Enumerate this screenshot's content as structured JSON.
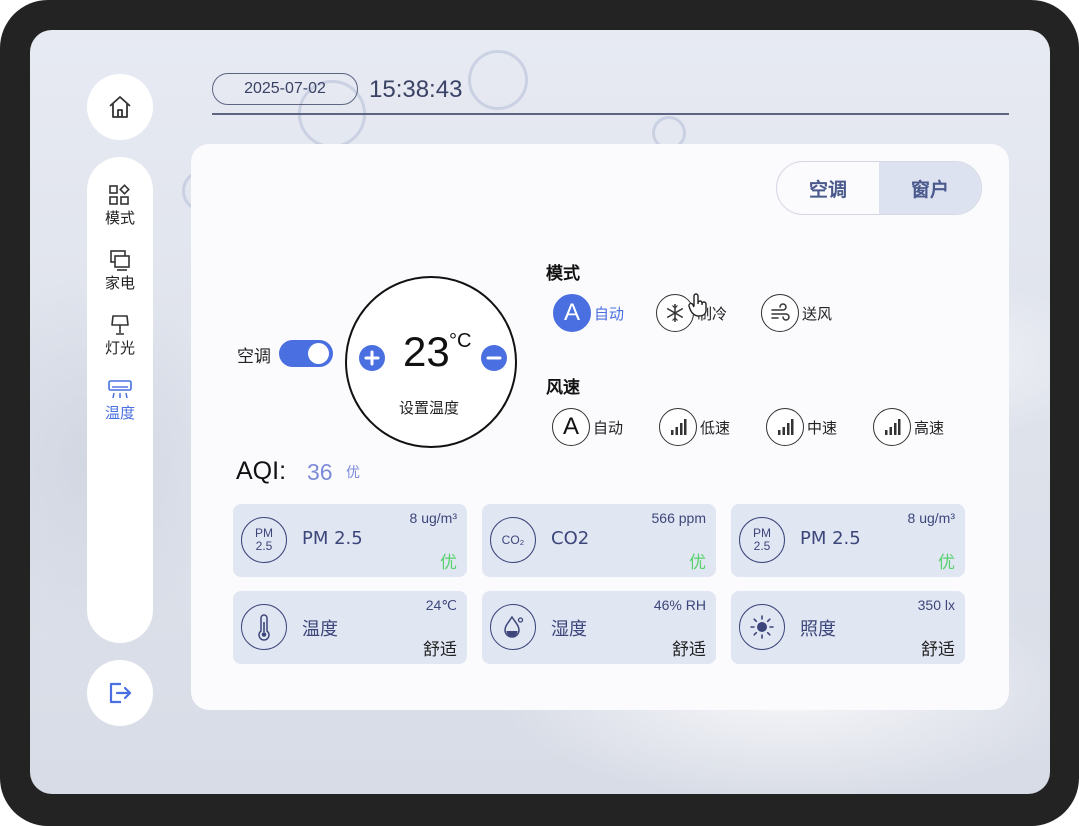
{
  "header": {
    "date": "2025-07-02",
    "time": "15:38:43"
  },
  "sidebar": {
    "items": [
      {
        "label": "模式",
        "icon": "grid-icon"
      },
      {
        "label": "家电",
        "icon": "appliance-icon"
      },
      {
        "label": "灯光",
        "icon": "lamp-icon"
      },
      {
        "label": "温度",
        "icon": "air-conditioner-icon"
      }
    ],
    "active": "温度"
  },
  "tabs": {
    "ac": "空调",
    "window": "窗户",
    "selected": "窗户"
  },
  "ac": {
    "label": "空调",
    "power": true,
    "temp": "23",
    "unit": "°C",
    "set_label": "设置温度"
  },
  "mode": {
    "title": "模式",
    "options": [
      {
        "label": "自动",
        "icon": "auto-icon",
        "selected": true
      },
      {
        "label": "制冷",
        "icon": "snowflake-icon",
        "selected": false
      },
      {
        "label": "送风",
        "icon": "wind-icon",
        "selected": false
      }
    ]
  },
  "fan": {
    "title": "风速",
    "options": [
      {
        "label": "自动",
        "icon": "auto-icon"
      },
      {
        "label": "低速",
        "icon": "signal-icon"
      },
      {
        "label": "中速",
        "icon": "signal-icon"
      },
      {
        "label": "高速",
        "icon": "signal-icon"
      }
    ]
  },
  "aqi": {
    "label": "AQI:",
    "value": "36",
    "level": "优"
  },
  "sensors": [
    {
      "name": "PM 2.5",
      "icon_text": "PM",
      "icon_sub": "2.5",
      "value": "8 ug/m³",
      "status": "优"
    },
    {
      "name": "CO2",
      "icon_text": "CO₂",
      "value": "566 ppm",
      "status": "优"
    },
    {
      "name": "PM 2.5",
      "icon_text": "PM",
      "icon_sub": "2.5",
      "value": "8 ug/m³",
      "status": "优"
    },
    {
      "name": "温度",
      "icon": "thermometer-icon",
      "value": "24℃",
      "status": "舒适"
    },
    {
      "name": "湿度",
      "icon": "humidity-icon",
      "value": "46% RH",
      "status": "舒适"
    },
    {
      "name": "照度",
      "icon": "sun-icon",
      "value": "350 lx",
      "status": "舒适"
    }
  ],
  "colors": {
    "accent": "#4a6fe0",
    "good": "#57d26c",
    "card": "#e1e6f3",
    "text_dark": "#3c467a"
  }
}
